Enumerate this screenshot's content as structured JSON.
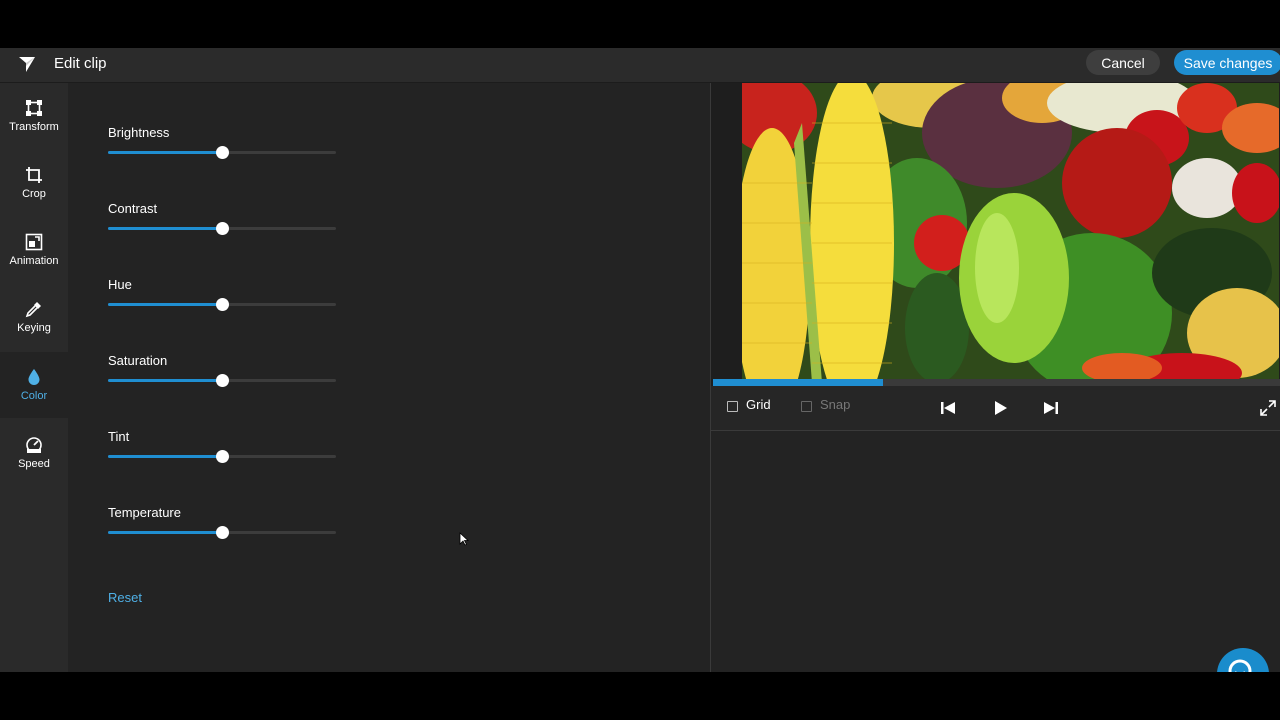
{
  "header": {
    "title": "Edit clip",
    "cancel_label": "Cancel",
    "save_label": "Save changes"
  },
  "sidebar": {
    "items": [
      {
        "label": "Transform",
        "icon": "transform-icon",
        "active": false
      },
      {
        "label": "Crop",
        "icon": "crop-icon",
        "active": false
      },
      {
        "label": "Animation",
        "icon": "animation-icon",
        "active": false
      },
      {
        "label": "Keying",
        "icon": "eyedropper-icon",
        "active": false
      },
      {
        "label": "Color",
        "icon": "droplet-icon",
        "active": true
      },
      {
        "label": "Speed",
        "icon": "speedometer-icon",
        "active": false
      }
    ]
  },
  "adjustments": {
    "sliders": [
      {
        "label": "Brightness",
        "value": 0.5
      },
      {
        "label": "Contrast",
        "value": 0.5
      },
      {
        "label": "Hue",
        "value": 0.5
      },
      {
        "label": "Saturation",
        "value": 0.5
      },
      {
        "label": "Tint",
        "value": 0.5
      },
      {
        "label": "Temperature",
        "value": 0.5
      }
    ],
    "reset_label": "Reset"
  },
  "preview": {
    "playback_progress": 0.3,
    "grid_label": "Grid",
    "grid_checked": false,
    "snap_label": "Snap",
    "snap_checked": false
  },
  "colors": {
    "accent": "#1f8ed1",
    "accent_text": "#4fb0e6",
    "background": "#232323",
    "topbar": "#2b2b2b"
  }
}
